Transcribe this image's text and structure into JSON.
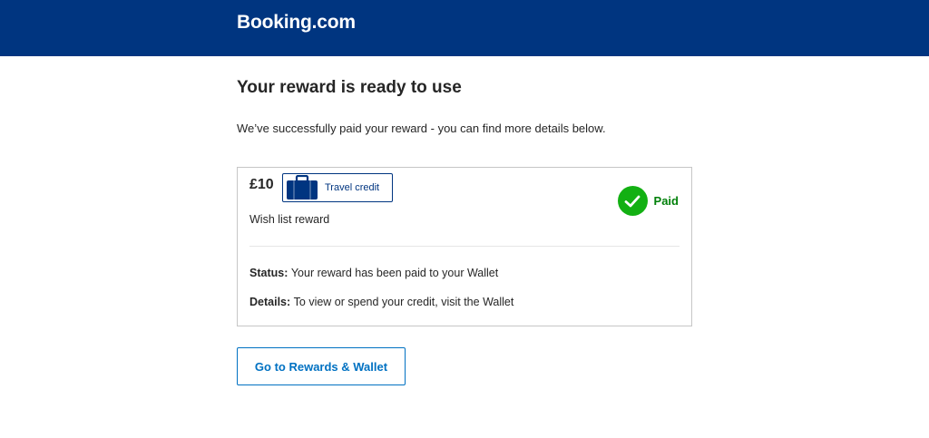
{
  "header": {
    "logo_text": "Booking.com",
    "background_color": "#003580"
  },
  "main": {
    "title": "Your reward is ready to use",
    "intro": "We’ve successfully paid your reward - you can find more details below."
  },
  "reward_card": {
    "amount": "£10",
    "badge": {
      "icon": "suitcase-icon",
      "label": "Travel credit"
    },
    "reward_name": "Wish list reward",
    "status_badge": {
      "icon": "checkmark-icon",
      "label": "Paid",
      "color": "#008009"
    },
    "status": {
      "key": "Status:",
      "value": "Your reward has been paid to your Wallet"
    },
    "details": {
      "key": "Details:",
      "value": "To view or spend your credit, visit the Wallet"
    }
  },
  "cta": {
    "label": "Go to Rewards & Wallet",
    "color": "#0071c2"
  }
}
